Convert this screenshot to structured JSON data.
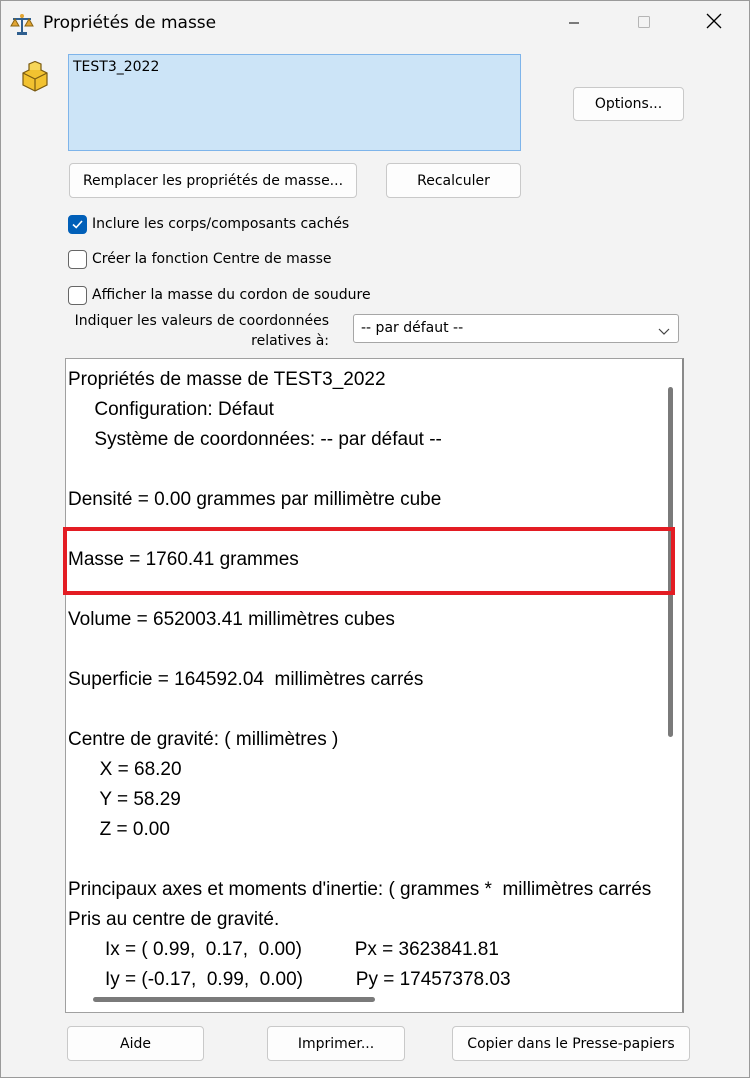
{
  "window": {
    "title": "Propriétés de masse"
  },
  "icons": {
    "app": "scale-icon",
    "part": "part-icon",
    "minimize": "minimize-icon",
    "maximize": "maximize-icon",
    "close": "close-icon",
    "check": "check-icon",
    "chevron": "chevron-down-icon"
  },
  "selection": {
    "item": "TEST3_2022"
  },
  "buttons": {
    "options": "Options...",
    "replace": "Remplacer les propriétés de masse...",
    "recalculate": "Recalculer",
    "help": "Aide",
    "print": "Imprimer...",
    "copy": "Copier dans le Presse-papiers"
  },
  "checkboxes": {
    "include_hidden": {
      "label": "Inclure les corps/composants cachés",
      "checked": true
    },
    "create_center": {
      "label": "Créer la fonction Centre de masse",
      "checked": false
    },
    "weld_mass": {
      "label": "Afficher la masse du cordon de soudure",
      "checked": false
    }
  },
  "coordinates": {
    "label_line1": "Indiquer les valeurs de coordonnées",
    "label_line2": "relatives à:",
    "selected": "-- par défaut --"
  },
  "results": {
    "lines": [
      "Propriétés de masse de TEST3_2022",
      "     Configuration: Défaut",
      "     Système de coordonnées: -- par défaut --",
      "",
      "Densité = 0.00 grammes par millimètre cube",
      "",
      "Masse = 1760.41 grammes",
      "",
      "Volume = 652003.41 millimètres cubes",
      "",
      "Superficie = 164592.04  millimètres carrés",
      "",
      "Centre de gravité: ( millimètres )",
      "      X = 68.20",
      "      Y = 58.29",
      "      Z = 0.00",
      "",
      "Principaux axes et moments d'inertie: ( grammes *  millimètres carrés )",
      "Pris au centre de gravité.",
      "       Ix = ( 0.99,  0.17,  0.00)          Px = 3623841.81",
      "       Iy = (-0.17,  0.99,  0.00)          Py = 17457378.03"
    ]
  },
  "colors": {
    "accent": "#005fb8",
    "selection_bg": "#cce4f7",
    "highlight": "#e31c23"
  }
}
